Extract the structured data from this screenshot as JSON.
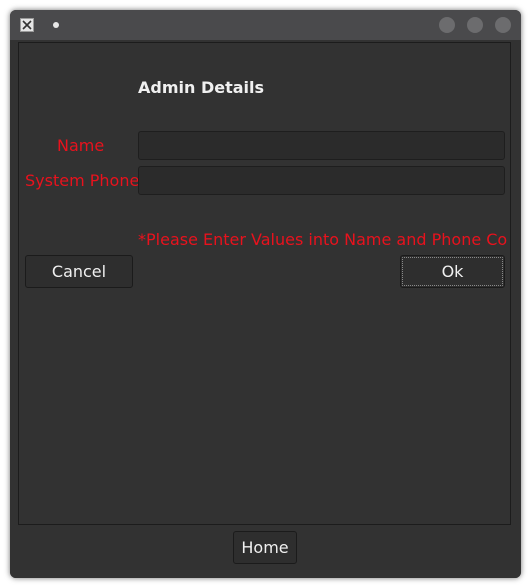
{
  "window": {
    "icon": "x-window-icon",
    "controls": [
      "minimize-icon",
      "maximize-icon",
      "close-icon"
    ]
  },
  "form": {
    "title": "Admin Details",
    "name_label": "Name",
    "name_value": "",
    "phone_label": "System Phone",
    "phone_value": "",
    "warning": "*Please Enter Values into Name and Phone Colur"
  },
  "buttons": {
    "cancel": "Cancel",
    "ok": "Ok",
    "home": "Home"
  },
  "colors": {
    "error_red": "#e8121d",
    "background": "#323232",
    "titlebar": "#4a4a4c"
  }
}
